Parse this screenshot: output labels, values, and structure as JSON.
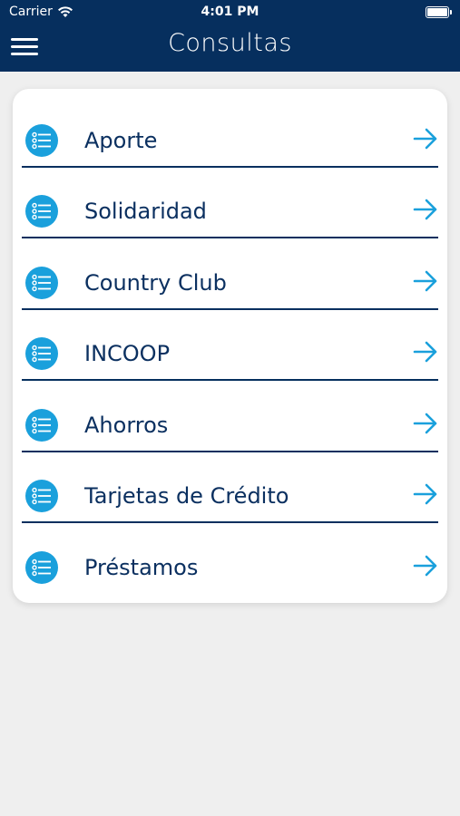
{
  "status_bar": {
    "carrier": "Carrier",
    "time": "4:01 PM"
  },
  "header": {
    "title": "Consultas",
    "menu_icon": "hamburger-icon"
  },
  "colors": {
    "header_bg": "#062f5e",
    "accent": "#1aa0dc",
    "text": "#0b3060",
    "background": "#efefef"
  },
  "items": [
    {
      "label": "Aporte"
    },
    {
      "label": "Solidaridad"
    },
    {
      "label": "Country Club"
    },
    {
      "label": "INCOOP"
    },
    {
      "label": "Ahorros"
    },
    {
      "label": "Tarjetas de Crédito"
    },
    {
      "label": "Préstamos"
    }
  ]
}
